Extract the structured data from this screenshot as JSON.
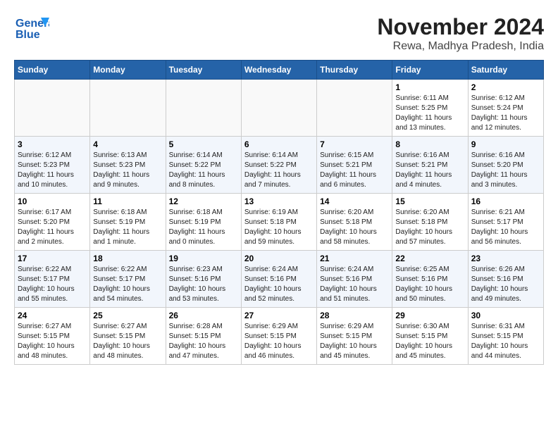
{
  "logo": {
    "line1": "General",
    "line2": "Blue"
  },
  "title": "November 2024",
  "location": "Rewa, Madhya Pradesh, India",
  "days_of_week": [
    "Sunday",
    "Monday",
    "Tuesday",
    "Wednesday",
    "Thursday",
    "Friday",
    "Saturday"
  ],
  "weeks": [
    [
      {
        "day": "",
        "info": ""
      },
      {
        "day": "",
        "info": ""
      },
      {
        "day": "",
        "info": ""
      },
      {
        "day": "",
        "info": ""
      },
      {
        "day": "",
        "info": ""
      },
      {
        "day": "1",
        "info": "Sunrise: 6:11 AM\nSunset: 5:25 PM\nDaylight: 11 hours\nand 13 minutes."
      },
      {
        "day": "2",
        "info": "Sunrise: 6:12 AM\nSunset: 5:24 PM\nDaylight: 11 hours\nand 12 minutes."
      }
    ],
    [
      {
        "day": "3",
        "info": "Sunrise: 6:12 AM\nSunset: 5:23 PM\nDaylight: 11 hours\nand 10 minutes."
      },
      {
        "day": "4",
        "info": "Sunrise: 6:13 AM\nSunset: 5:23 PM\nDaylight: 11 hours\nand 9 minutes."
      },
      {
        "day": "5",
        "info": "Sunrise: 6:14 AM\nSunset: 5:22 PM\nDaylight: 11 hours\nand 8 minutes."
      },
      {
        "day": "6",
        "info": "Sunrise: 6:14 AM\nSunset: 5:22 PM\nDaylight: 11 hours\nand 7 minutes."
      },
      {
        "day": "7",
        "info": "Sunrise: 6:15 AM\nSunset: 5:21 PM\nDaylight: 11 hours\nand 6 minutes."
      },
      {
        "day": "8",
        "info": "Sunrise: 6:16 AM\nSunset: 5:21 PM\nDaylight: 11 hours\nand 4 minutes."
      },
      {
        "day": "9",
        "info": "Sunrise: 6:16 AM\nSunset: 5:20 PM\nDaylight: 11 hours\nand 3 minutes."
      }
    ],
    [
      {
        "day": "10",
        "info": "Sunrise: 6:17 AM\nSunset: 5:20 PM\nDaylight: 11 hours\nand 2 minutes."
      },
      {
        "day": "11",
        "info": "Sunrise: 6:18 AM\nSunset: 5:19 PM\nDaylight: 11 hours\nand 1 minute."
      },
      {
        "day": "12",
        "info": "Sunrise: 6:18 AM\nSunset: 5:19 PM\nDaylight: 11 hours\nand 0 minutes."
      },
      {
        "day": "13",
        "info": "Sunrise: 6:19 AM\nSunset: 5:18 PM\nDaylight: 10 hours\nand 59 minutes."
      },
      {
        "day": "14",
        "info": "Sunrise: 6:20 AM\nSunset: 5:18 PM\nDaylight: 10 hours\nand 58 minutes."
      },
      {
        "day": "15",
        "info": "Sunrise: 6:20 AM\nSunset: 5:18 PM\nDaylight: 10 hours\nand 57 minutes."
      },
      {
        "day": "16",
        "info": "Sunrise: 6:21 AM\nSunset: 5:17 PM\nDaylight: 10 hours\nand 56 minutes."
      }
    ],
    [
      {
        "day": "17",
        "info": "Sunrise: 6:22 AM\nSunset: 5:17 PM\nDaylight: 10 hours\nand 55 minutes."
      },
      {
        "day": "18",
        "info": "Sunrise: 6:22 AM\nSunset: 5:17 PM\nDaylight: 10 hours\nand 54 minutes."
      },
      {
        "day": "19",
        "info": "Sunrise: 6:23 AM\nSunset: 5:16 PM\nDaylight: 10 hours\nand 53 minutes."
      },
      {
        "day": "20",
        "info": "Sunrise: 6:24 AM\nSunset: 5:16 PM\nDaylight: 10 hours\nand 52 minutes."
      },
      {
        "day": "21",
        "info": "Sunrise: 6:24 AM\nSunset: 5:16 PM\nDaylight: 10 hours\nand 51 minutes."
      },
      {
        "day": "22",
        "info": "Sunrise: 6:25 AM\nSunset: 5:16 PM\nDaylight: 10 hours\nand 50 minutes."
      },
      {
        "day": "23",
        "info": "Sunrise: 6:26 AM\nSunset: 5:16 PM\nDaylight: 10 hours\nand 49 minutes."
      }
    ],
    [
      {
        "day": "24",
        "info": "Sunrise: 6:27 AM\nSunset: 5:15 PM\nDaylight: 10 hours\nand 48 minutes."
      },
      {
        "day": "25",
        "info": "Sunrise: 6:27 AM\nSunset: 5:15 PM\nDaylight: 10 hours\nand 48 minutes."
      },
      {
        "day": "26",
        "info": "Sunrise: 6:28 AM\nSunset: 5:15 PM\nDaylight: 10 hours\nand 47 minutes."
      },
      {
        "day": "27",
        "info": "Sunrise: 6:29 AM\nSunset: 5:15 PM\nDaylight: 10 hours\nand 46 minutes."
      },
      {
        "day": "28",
        "info": "Sunrise: 6:29 AM\nSunset: 5:15 PM\nDaylight: 10 hours\nand 45 minutes."
      },
      {
        "day": "29",
        "info": "Sunrise: 6:30 AM\nSunset: 5:15 PM\nDaylight: 10 hours\nand 45 minutes."
      },
      {
        "day": "30",
        "info": "Sunrise: 6:31 AM\nSunset: 5:15 PM\nDaylight: 10 hours\nand 44 minutes."
      }
    ]
  ]
}
